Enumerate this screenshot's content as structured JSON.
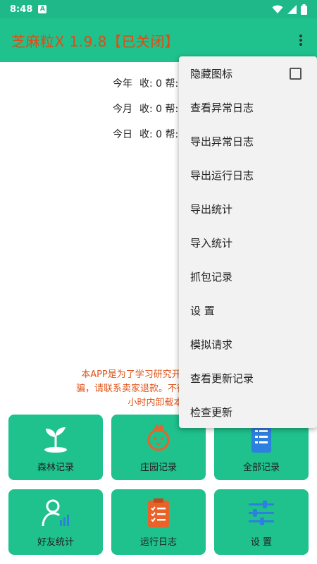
{
  "status_bar": {
    "time": "8:48",
    "notif_letter": "A"
  },
  "app_bar": {
    "title": "芝麻粒X 1.9.8【已关闭】"
  },
  "stats": [
    {
      "label": "今年",
      "values": "收: 0 帮: 0"
    },
    {
      "label": "今月",
      "values": "收: 0 帮: 0"
    },
    {
      "label": "今日",
      "values": "收: 0 帮: 0"
    }
  ],
  "notice": [
    "本APP是为了学习研究开发，免费提供",
    "骗，请联系卖家退款。不得进行任何形式",
    "小时内卸载本A"
  ],
  "tiles": [
    {
      "label": "森林记录",
      "icon": "sprout-icon"
    },
    {
      "label": "庄园记录",
      "icon": "chick-icon"
    },
    {
      "label": "全部记录",
      "icon": "clipboard-list-icon"
    },
    {
      "label": "好友统计",
      "icon": "user-stats-icon"
    },
    {
      "label": "运行日志",
      "icon": "log-clipboard-icon"
    },
    {
      "label": "设 置",
      "icon": "sliders-icon"
    }
  ],
  "menu": {
    "items": [
      "隐藏图标",
      "查看异常日志",
      "导出异常日志",
      "导出运行日志",
      "导出统计",
      "导入统计",
      "抓包记录",
      "设 置",
      "模拟请求",
      "查看更新记录",
      "检查更新"
    ],
    "hide_icon_checked": false
  },
  "colors": {
    "primary": "#1fc18d",
    "title": "#e24b12",
    "notice": "#e0541a"
  }
}
